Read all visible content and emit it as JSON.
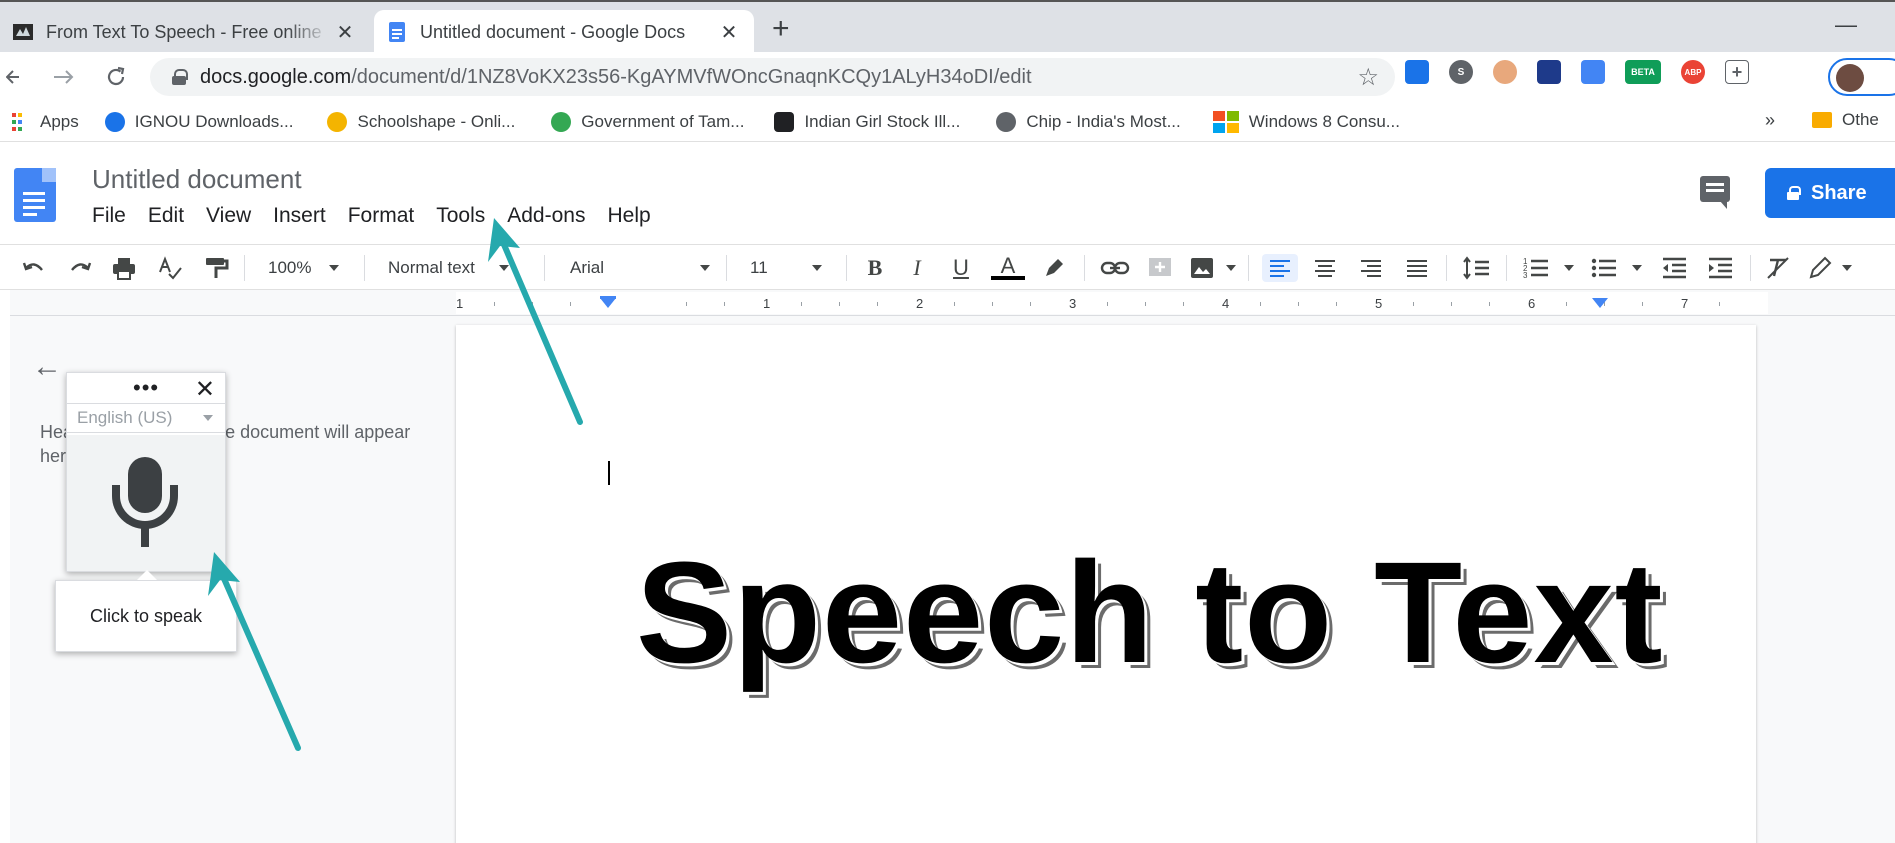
{
  "browser": {
    "tabs": [
      {
        "title": "From Text To Speech - Free online",
        "close": "✕",
        "active": false
      },
      {
        "title": "Untitled document - Google Docs",
        "close": "✕",
        "active": true
      }
    ],
    "new_tab": "+",
    "minimize": "—",
    "url_host": "docs.google.com",
    "url_path": "/document/d/1NZ8VoKX23s56-KgAYMVfWOncGnaqnKCQy1ALyH34oDI/edit",
    "extensions": [
      {
        "icon": "extension-blue-icon",
        "color": "#1a73e8",
        "label": ""
      },
      {
        "icon": "skype-icon",
        "color": "#5f6368",
        "label": "S"
      },
      {
        "icon": "person-extension-icon",
        "color": "#e8a87c",
        "label": ""
      },
      {
        "icon": "globe-extension-icon",
        "color": "#1e3a8a",
        "label": ""
      },
      {
        "icon": "translate-icon",
        "color": "#4285f4",
        "label": ""
      },
      {
        "icon": "beta-extension-icon",
        "color": "#0f9d58",
        "label": "BETA"
      },
      {
        "icon": "adblock-icon",
        "color": "#ea4335",
        "label": "ABP"
      },
      {
        "icon": "plus-box-icon",
        "color": "#ffffff",
        "label": "+"
      }
    ]
  },
  "bookmarks": {
    "items": [
      {
        "label": "Apps",
        "icon": "apps-grid-icon",
        "color": "#ea4335"
      },
      {
        "label": "IGNOU Downloads...",
        "icon": "ignou-icon",
        "color": "#1a73e8"
      },
      {
        "label": "Schoolshape - Onli...",
        "icon": "schoolshape-icon",
        "color": "#f4b400"
      },
      {
        "label": "Government of Tam...",
        "icon": "government-seal-icon",
        "color": "#34a853"
      },
      {
        "label": "Indian Girl Stock Ill...",
        "icon": "stock-image-icon",
        "color": "#202124"
      },
      {
        "label": "Chip - India's Most...",
        "icon": "chip-globe-icon",
        "color": "#5f6368"
      },
      {
        "label": "Windows 8 Consu...",
        "icon": "windows-logo-icon",
        "color": "#f25022"
      }
    ],
    "more": "»",
    "other": "Othe"
  },
  "docs": {
    "title": "Untitled document",
    "menu": [
      "File",
      "Edit",
      "View",
      "Insert",
      "Format",
      "Tools",
      "Add-ons",
      "Help"
    ],
    "share_label": "Share",
    "accent": "#1a73e8"
  },
  "toolbar": {
    "zoom": "100%",
    "style": "Normal text",
    "font": "Arial",
    "size": "11"
  },
  "ruler": {
    "numbers": [
      "1",
      "1",
      "2",
      "3",
      "4",
      "5",
      "6",
      "7"
    ]
  },
  "outline": {
    "text": "Headings you add to the document will appear here."
  },
  "voice_typing": {
    "dots": "•••",
    "close": "✕",
    "language": "English (US)",
    "tooltip": "Click to speak"
  },
  "document": {
    "body_text": "Speech to Text"
  },
  "annotation": {
    "arrow_color": "#26a9ad"
  }
}
